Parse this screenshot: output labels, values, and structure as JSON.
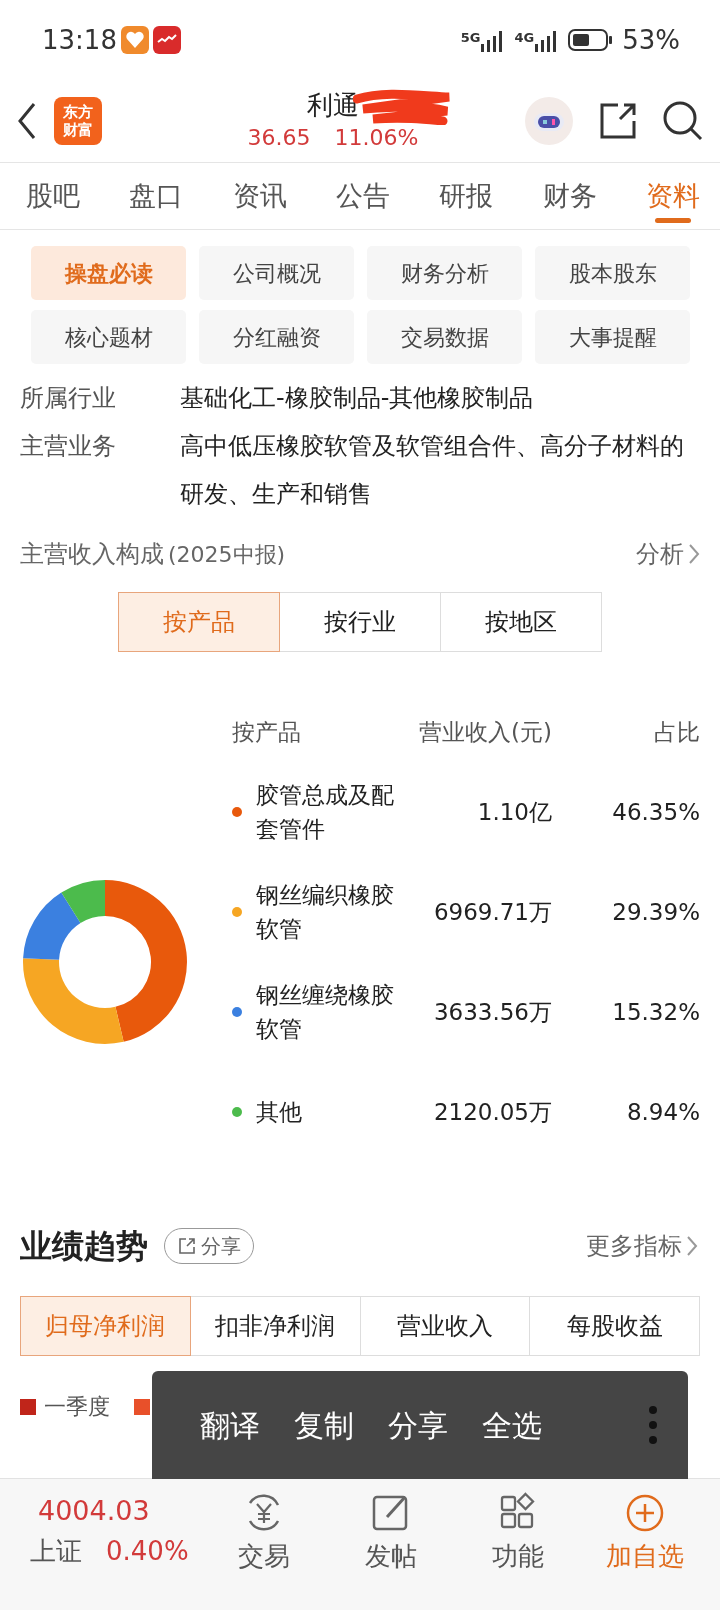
{
  "status_bar": {
    "time": "13:18",
    "net1": "5G",
    "net2": "4G",
    "battery": "53%"
  },
  "header": {
    "logo": [
      "东方",
      "财富"
    ],
    "title": "利通",
    "price": "36.65",
    "change": "11.06%"
  },
  "tabs": [
    {
      "label": "股吧",
      "selected": false
    },
    {
      "label": "盘口",
      "selected": false
    },
    {
      "label": "资讯",
      "selected": false
    },
    {
      "label": "公告",
      "selected": false
    },
    {
      "label": "研报",
      "selected": false
    },
    {
      "label": "财务",
      "selected": false
    },
    {
      "label": "资料",
      "selected": true
    }
  ],
  "sub_buttons": [
    {
      "label": "操盘必读",
      "selected": true
    },
    {
      "label": "公司概况",
      "selected": false
    },
    {
      "label": "财务分析",
      "selected": false
    },
    {
      "label": "股本股东",
      "selected": false
    },
    {
      "label": "核心题材",
      "selected": false
    },
    {
      "label": "分红融资",
      "selected": false
    },
    {
      "label": "交易数据",
      "selected": false
    },
    {
      "label": "大事提醒",
      "selected": false
    }
  ],
  "info": [
    {
      "label": "所属行业",
      "value": "基础化工-橡胶制品-其他橡胶制品"
    },
    {
      "label": "主营业务",
      "value": "高中低压橡胶软管及软管组合件、高分子材料的研发、生产和销售"
    }
  ],
  "revenue": {
    "title": "主营收入构成",
    "period": "(2025中报)",
    "link": "分析",
    "segments": [
      {
        "label": "按产品",
        "selected": true
      },
      {
        "label": "按行业",
        "selected": false
      },
      {
        "label": "按地区",
        "selected": false
      }
    ],
    "columns": [
      "按产品",
      "营业收入(元)",
      "占比"
    ],
    "rows": [
      {
        "revenue": "1.10亿",
        "share": "46.35%",
        "color": "#e8590c"
      },
      {
        "revenue": "6969.71万",
        "share": "29.39%",
        "color": "#f6a623"
      },
      {
        "revenue": "3633.56万",
        "share": "15.32%",
        "color": "#3b80e0"
      },
      {
        "revenue": "2120.05万",
        "share": "8.94%",
        "color": "#4cbb4c"
      }
    ],
    "chart_data": {
      "type": "donut",
      "categories": [
        "胶管总成及配套管件",
        "钢丝编织橡胶软管",
        "钢丝缠绕橡胶软管",
        "其他"
      ],
      "values": [
        46.35,
        29.39,
        15.32,
        8.94
      ]
    }
  },
  "performance": {
    "title": "业绩趋势",
    "share": "分享",
    "link": "更多指标",
    "tabs": [
      {
        "label": "归母净利润",
        "selected": true
      },
      {
        "label": "扣非净利润",
        "selected": false
      },
      {
        "label": "营业收入",
        "selected": false
      },
      {
        "label": "每股收益",
        "selected": false
      }
    ],
    "legend": [
      {
        "label": "一季度",
        "color": "#c0251a"
      },
      {
        "color": "#e8502a"
      }
    ]
  },
  "popup": {
    "items": [
      "翻译",
      "复制",
      "分享",
      "全选"
    ]
  },
  "bottom_bar": {
    "index_value": "4004.03",
    "index_name": "上证",
    "index_change": "0.40%",
    "items": [
      {
        "label": "交易",
        "highlighted": false
      },
      {
        "label": "发帖",
        "highlighted": false
      },
      {
        "label": "功能",
        "highlighted": false
      },
      {
        "label": "加自选",
        "highlighted": true
      }
    ]
  }
}
